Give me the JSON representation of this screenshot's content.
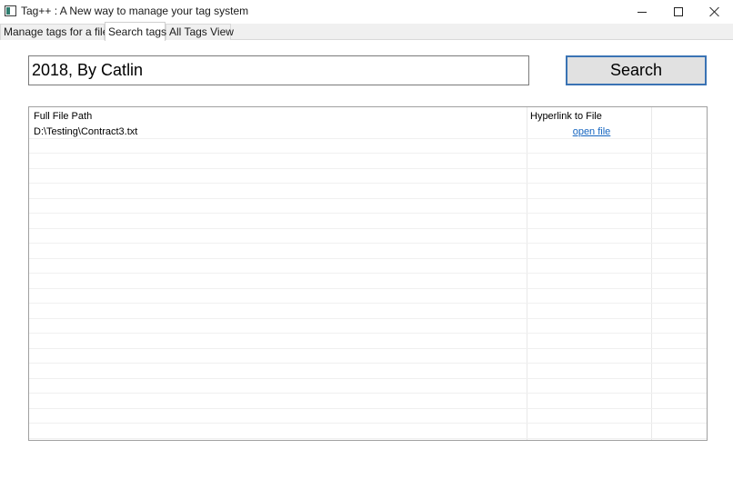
{
  "window": {
    "title": "Tag++ : A New way to manage your tag system",
    "icon": "app-icon",
    "controls": [
      "minimize-icon",
      "maximize-icon",
      "close-icon"
    ]
  },
  "tabs": [
    {
      "label": "Manage tags for a file",
      "active": false
    },
    {
      "label": "Search tags",
      "active": true
    },
    {
      "label": "All Tags View",
      "active": false
    }
  ],
  "search": {
    "value": "2018, By Catlin",
    "button_label": "Search"
  },
  "grid": {
    "columns": [
      "Full File Path",
      "Hyperlink to File"
    ],
    "rows": [
      {
        "path": "D:\\Testing\\Contract3.txt",
        "link": "open file"
      }
    ],
    "empty_rows": 20
  },
  "colors": {
    "accent_border": "#3a73b4",
    "link": "#1565c0",
    "button_bg": "#e1e1e1"
  }
}
